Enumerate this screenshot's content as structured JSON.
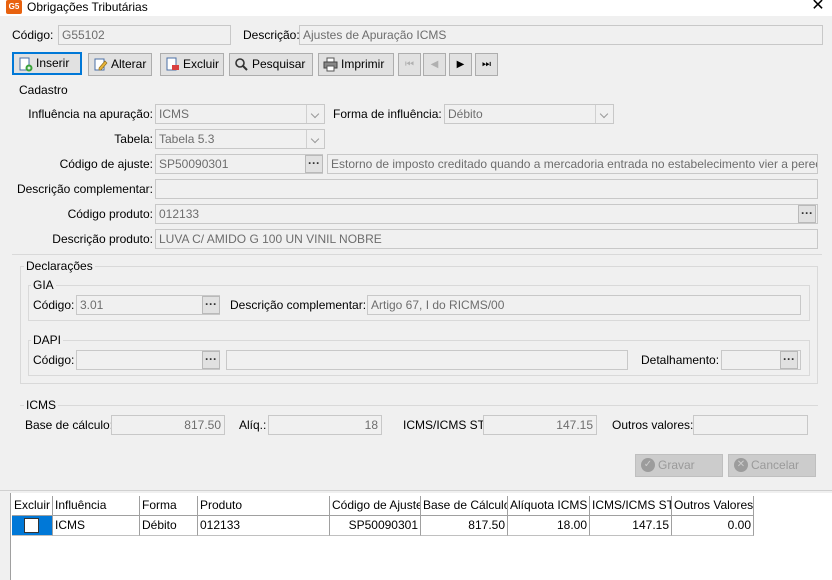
{
  "window": {
    "title": "Obrigações Tributárias",
    "app_icon": "G5"
  },
  "header": {
    "codigo_label": "Código:",
    "codigo_value": "G55102",
    "descricao_label": "Descrição:",
    "descricao_value": "Ajustes de Apuração ICMS"
  },
  "toolbar": {
    "inserir": "Inserir",
    "alterar": "Alterar",
    "excluir": "Excluir",
    "pesquisar": "Pesquisar",
    "imprimir": "Imprimir"
  },
  "cadastro": {
    "title": "Cadastro",
    "influencia_label": "Influência na apuração:",
    "influencia_value": "ICMS",
    "forma_label": "Forma de influência:",
    "forma_value": "Débito",
    "tabela_label": "Tabela:",
    "tabela_value": "Tabela 5.3",
    "codigo_ajuste_label": "Código de ajuste:",
    "codigo_ajuste_value": "SP50090301",
    "codigo_ajuste_desc": "Estorno de imposto creditado quando a mercadoria entrada no estabelecimento vier a perecer",
    "desc_compl_label": "Descrição complementar:",
    "desc_compl_value": "",
    "codigo_produto_label": "Código produto:",
    "codigo_produto_value": "012133",
    "descricao_produto_label": "Descrição produto:",
    "descricao_produto_value": "LUVA C/ AMIDO G 100 UN VINIL NOBRE"
  },
  "declaracoes": {
    "title": "Declarações",
    "gia": {
      "title": "GIA",
      "codigo_label": "Código:",
      "codigo_value": "3.01",
      "desc_label": "Descrição complementar:",
      "desc_value": "Artigo 67, I do RICMS/00"
    },
    "dapi": {
      "title": "DAPI",
      "codigo_label": "Código:",
      "codigo_value": "",
      "desc_value": "",
      "detalhamento_label": "Detalhamento:",
      "detalhamento_value": ""
    }
  },
  "icms": {
    "title": "ICMS",
    "base_label": "Base de cálculo:",
    "base_value": "817.50",
    "aliq_label": "Alíq.:",
    "aliq_value": "18",
    "icms_st_label": "ICMS/ICMS ST:",
    "icms_st_value": "147.15",
    "outros_label": "Outros valores:",
    "outros_value": ""
  },
  "actions": {
    "gravar": "Gravar",
    "cancelar": "Cancelar"
  },
  "grid": {
    "columns": [
      "Excluir",
      "Influência",
      "Forma",
      "Produto",
      "Código de Ajuste",
      "Base de Cálculo",
      "Alíquota ICMS",
      "ICMS/ICMS ST",
      "Outros Valores"
    ],
    "rows": [
      {
        "influencia": "ICMS",
        "forma": "Débito",
        "produto": "012133",
        "codigo": "SP50090301",
        "base": "817.50",
        "aliquota": "18.00",
        "icms": "147.15",
        "outros": "0.00"
      }
    ]
  },
  "colors": {
    "accent": "#0078d7",
    "app_icon": "#e8620f"
  }
}
